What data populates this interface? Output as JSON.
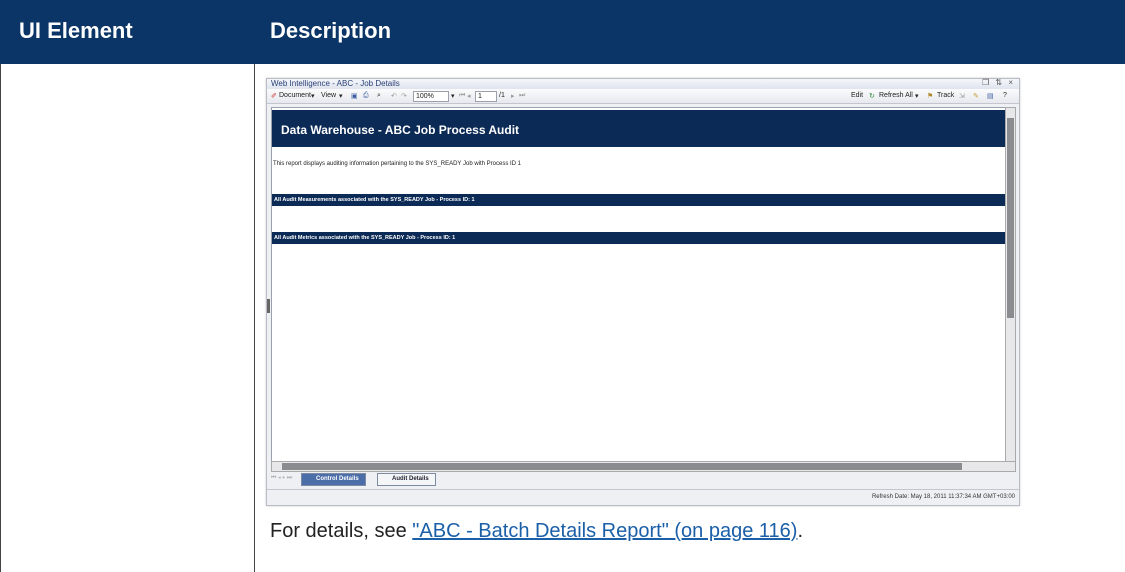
{
  "table": {
    "headers": [
      "UI Element",
      "Description"
    ],
    "caption_prefix": "For details, see ",
    "caption_link": "\"ABC - Batch Details Report\" (on page 116)",
    "caption_suffix": "."
  },
  "window": {
    "title": "Web Intelligence - ABC - Job Details",
    "controls": "❐ ⇅ ×",
    "toolbar": {
      "document": "Document",
      "view": "View",
      "zoom": "100%",
      "page": "1",
      "page_total": "/1",
      "edit": "Edit",
      "refresh_all": "Refresh All",
      "track": "Track"
    },
    "report": {
      "banner_title": "Data Warehouse - ABC Job Process Audit",
      "description": "This report displays auditing information pertaining to the SYS_READY Job with Process ID 1",
      "section1": "All Audit Measurements associated with the SYS_READY Job  -  Process ID: 1",
      "section2": "All Audit Metrics associated with the SYS_READY Job  -  Process ID: 1"
    },
    "tabs": [
      "Control Details",
      "Audit Details"
    ],
    "status": "Refresh Date: May 18, 2011 11:37:34 AM GMT+03:00"
  }
}
